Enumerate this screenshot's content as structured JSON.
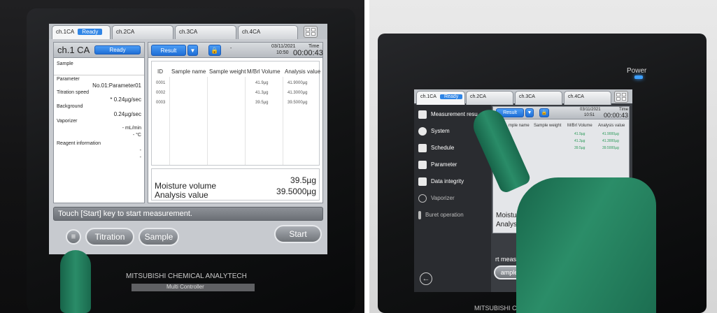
{
  "left": {
    "tabs": [
      "ch.1CA",
      "ch.2CA",
      "ch.3CA",
      "ch.4CA"
    ],
    "active_tab_status": "Ready",
    "panel_title": "ch.1 CA",
    "panel_status": "Ready",
    "sample_label": "Sample",
    "parameter_label": "Parameter",
    "parameter_value": "No.01:Parameter01",
    "titration_speed_label": "Titration speed",
    "titration_speed_value": "* 0.24µg/sec",
    "background_label": "Background",
    "background_value": "0.24µg/sec",
    "vaporizer_label": "Vaporizer",
    "vaporizer_flow": "- mL/min",
    "vaporizer_temp": "- °C",
    "reagent_label": "Reagent information",
    "reagent_value_1": "-",
    "reagent_value_2": "-",
    "result_button": "Result",
    "date": "03/11/2021",
    "clock": "10:50",
    "time_label": "Time",
    "elapsed": "00:00:43",
    "table_headers": [
      "ID",
      "Sample name",
      "Sample weight",
      "M/Brl Volume",
      "Analysis value"
    ],
    "rows": [
      {
        "id": "0001",
        "volume": "41.9µg",
        "analysis": "41.9000µg"
      },
      {
        "id": "0002",
        "volume": "41.3µg",
        "analysis": "41.3000µg"
      },
      {
        "id": "0003",
        "volume": "39.5µg",
        "analysis": "39.5000µg"
      }
    ],
    "moisture_label": "Moisture volume",
    "moisture_value": "39.5µg",
    "analysis_label": "Analysis value",
    "analysis_value": "39.5000µg",
    "message": "Touch [Start] key to start measurement.",
    "menu_icon": "menu-icon",
    "titration_button": "Titration",
    "sample_button": "Sample",
    "start_button": "Start",
    "brand": "MITSUBISHI CHEMICAL ANALYTECH",
    "model": "Multi Controller"
  },
  "right": {
    "power_label": "Power",
    "tabs": [
      "ch.1CA",
      "ch.2CA",
      "ch.3CA",
      "ch.4CA"
    ],
    "active_tab_status": "Ready",
    "menu_items": [
      {
        "label": "Measurement resu",
        "icon": "document-icon"
      },
      {
        "label": "System",
        "icon": "gear-icon"
      },
      {
        "label": "Schedule",
        "icon": "calendar-icon"
      },
      {
        "label": "Parameter",
        "icon": "sliders-icon"
      },
      {
        "label": "Data integrity",
        "icon": "user-lock-icon"
      },
      {
        "label": "Vaporizer",
        "icon": "vaporizer-icon"
      },
      {
        "label": "Buret operation",
        "icon": "buret-icon"
      }
    ],
    "result_button": "Result",
    "date": "03/11/2021",
    "clock": "10:51",
    "time_label": "Time",
    "elapsed": "00:00:43",
    "table_headers": [
      "mple name",
      "Sample weight",
      "M/Brl Volume",
      "Analysis value"
    ],
    "rows": [
      {
        "volume": "41.9µg",
        "analysis": "41.9000µg"
      },
      {
        "volume": "41.3µg",
        "analysis": "41.3000µg"
      },
      {
        "volume": "39.5µg",
        "analysis": "39.5000µg"
      }
    ],
    "moisture_partial": "Moisture v",
    "analysis_partial": "Analysis",
    "message_partial": "rt measur",
    "sample_partial": "ample",
    "back_icon": "back-arrow-icon",
    "brand_partial": "MITSUBISHI CH"
  }
}
